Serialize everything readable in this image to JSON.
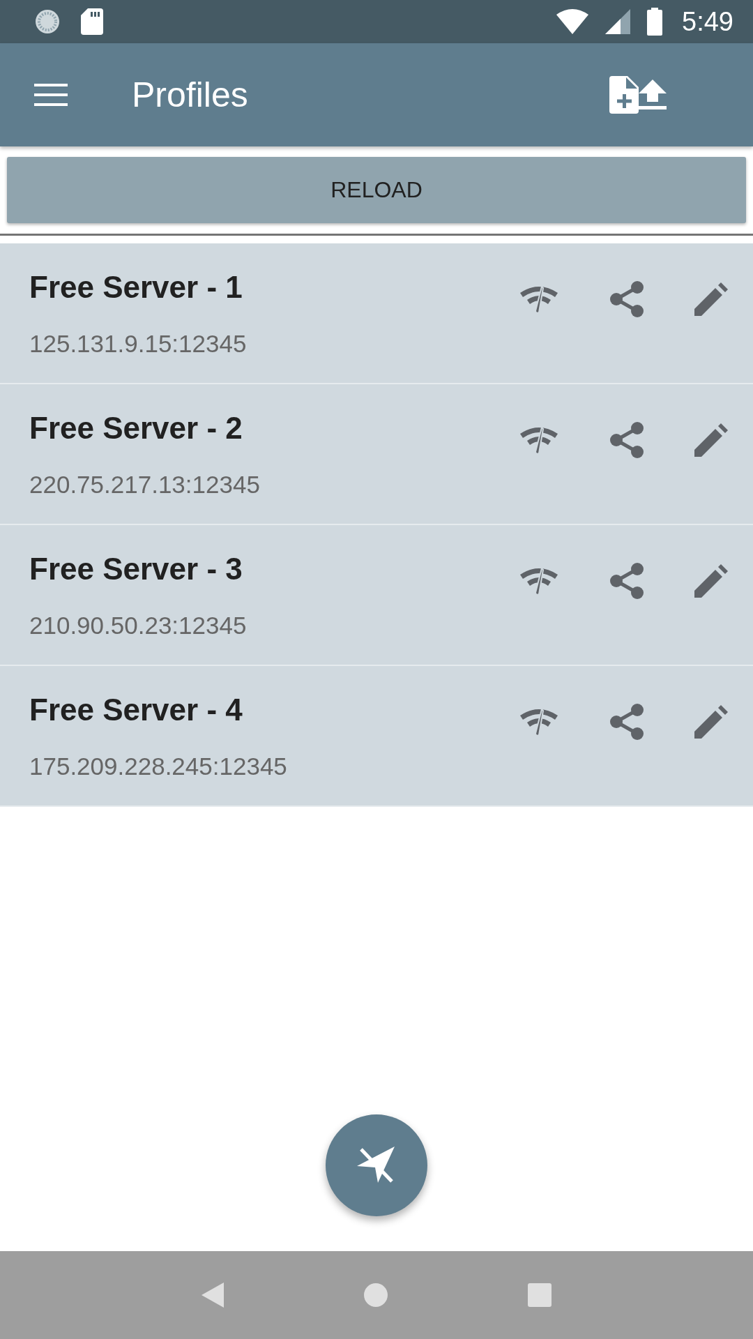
{
  "status_bar": {
    "time": "5:49"
  },
  "toolbar": {
    "title": "Profiles"
  },
  "reload_button": {
    "label": "RELOAD"
  },
  "profiles": [
    {
      "name": "Free Server - 1",
      "address": "125.131.9.15:12345"
    },
    {
      "name": "Free Server - 2",
      "address": "220.75.217.13:12345"
    },
    {
      "name": "Free Server - 3",
      "address": "210.90.50.23:12345"
    },
    {
      "name": "Free Server - 4",
      "address": "175.209.228.245:12345"
    }
  ]
}
